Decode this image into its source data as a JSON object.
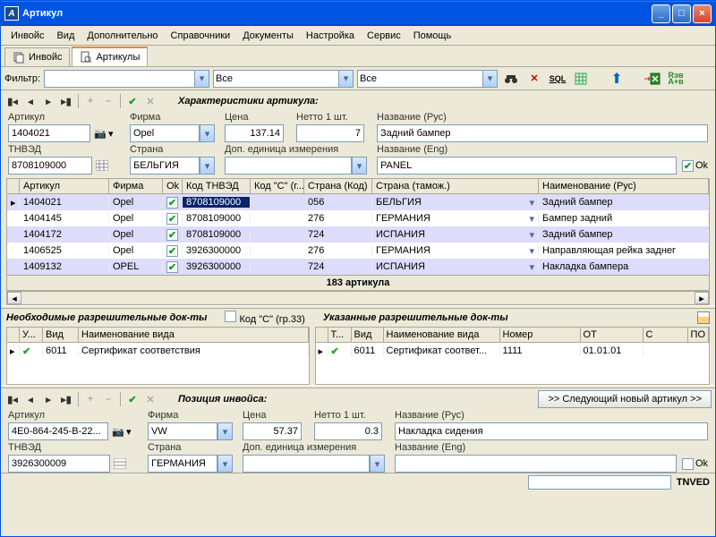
{
  "window": {
    "title": "Артикул"
  },
  "menu": [
    "Инвойс",
    "Вид",
    "Дополнительно",
    "Справочники",
    "Документы",
    "Настройка",
    "Сервис",
    "Помощь"
  ],
  "tabs": [
    {
      "label": "Инвойс",
      "active": false
    },
    {
      "label": "Артикулы",
      "active": true
    }
  ],
  "filter": {
    "label": "Фильтр:",
    "v1": "",
    "v2": "Все",
    "v3": "Все"
  },
  "section_char": "Характеристики артикула:",
  "top_form": {
    "artikul": {
      "label": "Артикул",
      "value": "1404021"
    },
    "firma": {
      "label": "Фирма",
      "value": "Opel"
    },
    "cena": {
      "label": "Цена",
      "value": "137.14"
    },
    "netto": {
      "label": "Нетто 1 шт.",
      "value": "7"
    },
    "name_rus": {
      "label": "Название (Рус)",
      "value": "Задний бампер"
    },
    "tnved": {
      "label": "ТНВЭД",
      "value": "8708109000"
    },
    "country": {
      "label": "Страна",
      "value": "БЕЛЬГИЯ"
    },
    "dop": {
      "label": "Доп. единица измерения",
      "value": ""
    },
    "name_eng": {
      "label": "Название (Eng)",
      "value": "PANEL"
    },
    "ok_label": "Ok"
  },
  "grid": {
    "headers": [
      "Артикул",
      "Фирма",
      "Ok",
      "Код ТНВЭД",
      "Код \"С\" (г...",
      "Страна (Код)",
      "Страна (тамож.)",
      "Наименование (Рус)"
    ],
    "rows": [
      {
        "artikul": "1404021",
        "firma": "Opel",
        "ok": true,
        "tnved": "8708109000",
        "codc": "",
        "ctry": "056",
        "ctryt": "БЕЛЬГИЯ",
        "name": "Задний бампер",
        "sel": true,
        "active": true
      },
      {
        "artikul": "1404145",
        "firma": "Opel",
        "ok": true,
        "tnved": "8708109000",
        "codc": "",
        "ctry": "276",
        "ctryt": "ГЕРМАНИЯ",
        "name": "Бампер задний"
      },
      {
        "artikul": "1404172",
        "firma": "Opel",
        "ok": true,
        "tnved": "8708109000",
        "codc": "",
        "ctry": "724",
        "ctryt": "ИСПАНИЯ",
        "name": "Задний бампер"
      },
      {
        "artikul": "1406525",
        "firma": "Opel",
        "ok": true,
        "tnved": "3926300000",
        "codc": "",
        "ctry": "276",
        "ctryt": "ГЕРМАНИЯ",
        "name": "Направляющая рейка заднег"
      },
      {
        "artikul": "1409132",
        "firma": "OPEL",
        "ok": true,
        "tnved": "3926300000",
        "codc": "",
        "ctry": "724",
        "ctryt": "ИСПАНИЯ",
        "name": "Накладка бампера"
      }
    ],
    "footer": "183 артикула"
  },
  "docs_hdr": {
    "left": "Необходимые разрешительные док-ты",
    "chk": "Код \"С\" (гр.33)",
    "right": "Указанные разрешительные док-ты"
  },
  "docs_left": {
    "headers": [
      "У...",
      "Вид",
      "Наименование вида"
    ],
    "row": {
      "vid": "6011",
      "name": "Сертификат соответствия"
    }
  },
  "docs_right": {
    "headers": [
      "Т...",
      "Вид",
      "Наименование вида",
      "Номер",
      "ОТ",
      "С",
      "ПО"
    ],
    "row": {
      "vid": "6011",
      "name": "Сертификат соответ...",
      "num": "1111",
      "ot": "01.01.01",
      "s": "",
      "po": ""
    }
  },
  "section_pos": "Позиция инвойса:",
  "next_btn": ">> Следующий новый артикул >>",
  "bot_form": {
    "artikul": {
      "label": "Артикул",
      "value": "4E0-864-245-B-22..."
    },
    "firma": {
      "label": "Фирма",
      "value": "VW"
    },
    "cena": {
      "label": "Цена",
      "value": "57.37"
    },
    "netto": {
      "label": "Нетто 1 шт.",
      "value": "0.3"
    },
    "name_rus": {
      "label": "Название (Рус)",
      "value": "Накладка сидения"
    },
    "tnved": {
      "label": "ТНВЭД",
      "value": "3926300009"
    },
    "country": {
      "label": "Страна",
      "value": "ГЕРМАНИЯ"
    },
    "dop": {
      "label": "Доп. единица измерения",
      "value": ""
    },
    "name_eng": {
      "label": "Название (Eng)",
      "value": ""
    },
    "ok_label": "Ok"
  },
  "status": {
    "value": "",
    "label": "TNVED"
  }
}
